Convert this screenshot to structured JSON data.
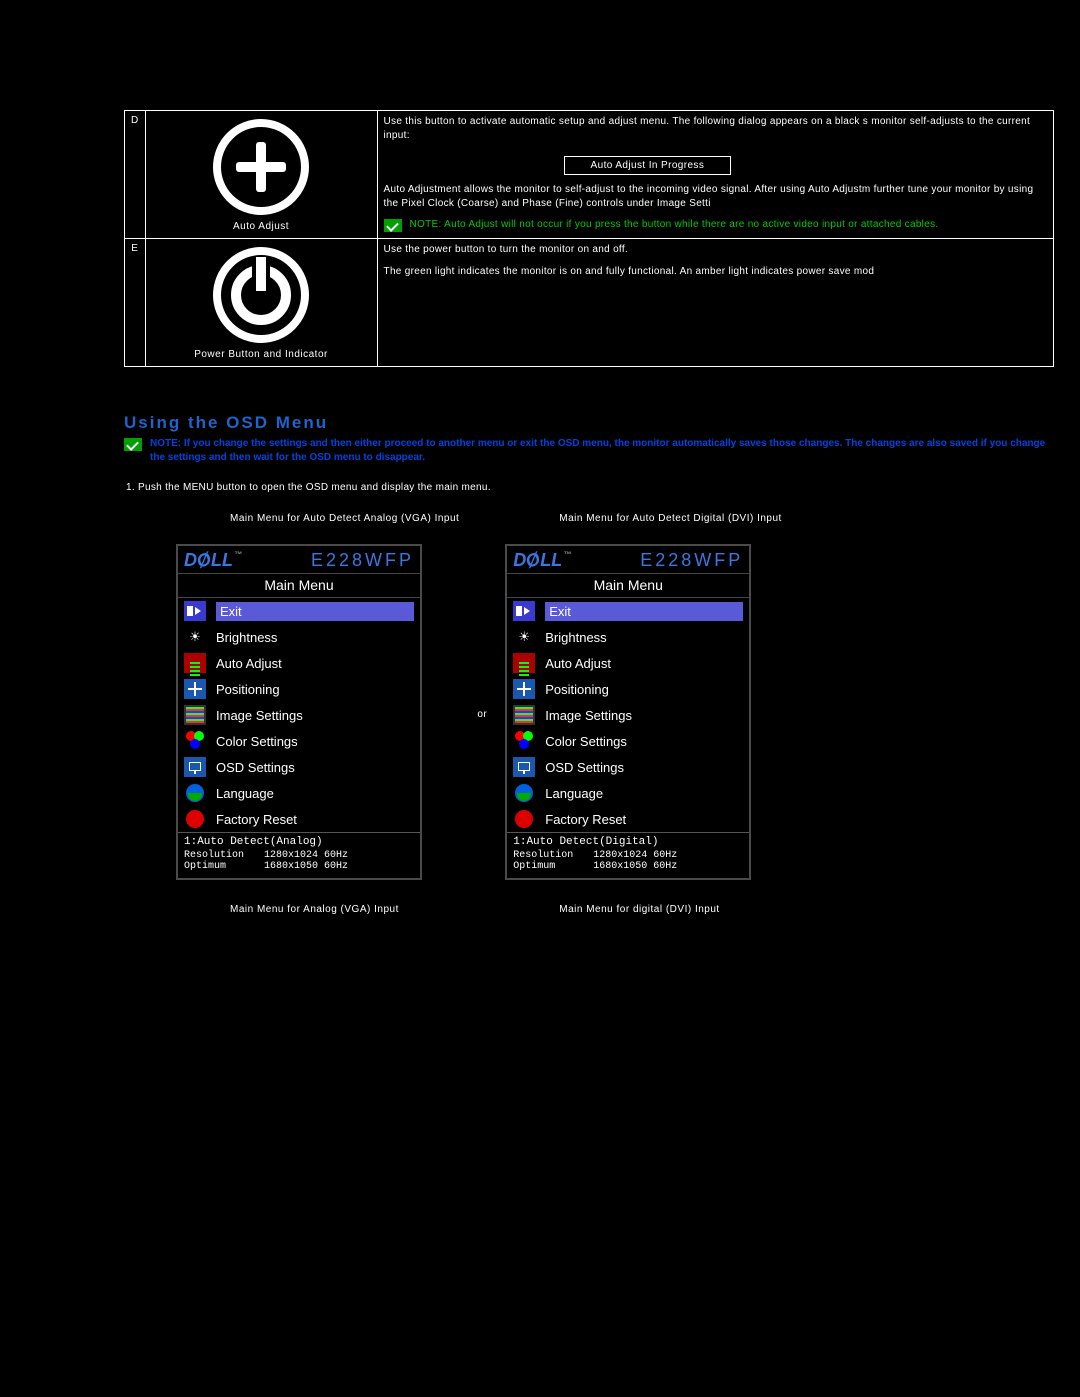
{
  "rows": {
    "d": {
      "letter": "D",
      "caption": "Auto Adjust",
      "para1": "Use this button to activate automatic setup and adjust menu. The following dialog appears on a black s\nmonitor self-adjusts to the current input:",
      "progress": "Auto Adjust In Progress",
      "para2": "Auto Adjustment allows the monitor to self-adjust to the incoming video signal. After using Auto Adjustm\nfurther tune your monitor by using the Pixel Clock (Coarse) and Phase (Fine) controls under Image Setti",
      "note": "NOTE: Auto Adjust will not occur if you press the button while there are no active video input\nor attached cables."
    },
    "e": {
      "letter": "E",
      "caption": "Power Button and Indicator",
      "para1": "Use the power button to turn the monitor on and off.",
      "para2": "The green light indicates the monitor is on and fully functional. An amber light indicates power save mod"
    }
  },
  "section": {
    "title": "Using the OSD Menu",
    "note": "NOTE: If you change the settings and then either proceed to another menu or exit the OSD menu, the monitor automatically saves those changes. The changes are also saved if you change the settings and then wait for the OSD menu to disappear.",
    "step1": "Push the MENU button to open the OSD menu and display the main menu.",
    "cap_analog_detect": "Main Menu for Auto Detect Analog (VGA) Input",
    "cap_digital_detect": "Main Menu for Auto Detect Digital (DVI) Input",
    "or": "or",
    "cap_analog": "Main Menu for Analog (VGA) Input",
    "cap_digital": "Main Menu for digital (DVI) Input"
  },
  "osd": {
    "logo": "D&LL",
    "model": "E228WFP",
    "main": "Main Menu",
    "items": [
      "Exit",
      "Brightness",
      "Auto Adjust",
      "Positioning",
      "Image Settings",
      "Color Settings",
      "OSD Settings",
      "Language",
      "Factory Reset"
    ],
    "analog": {
      "title": "1:Auto Detect(Analog)",
      "res_k": "Resolution",
      "res_v": "1280x1024  60Hz",
      "opt_k": "Optimum",
      "opt_v": "1680x1050  60Hz"
    },
    "digital": {
      "title": "1:Auto Detect(Digital)",
      "res_k": "Resolution",
      "res_v": "1280x1024  60Hz",
      "opt_k": "Optimum",
      "opt_v": "1680x1050  60Hz"
    }
  }
}
